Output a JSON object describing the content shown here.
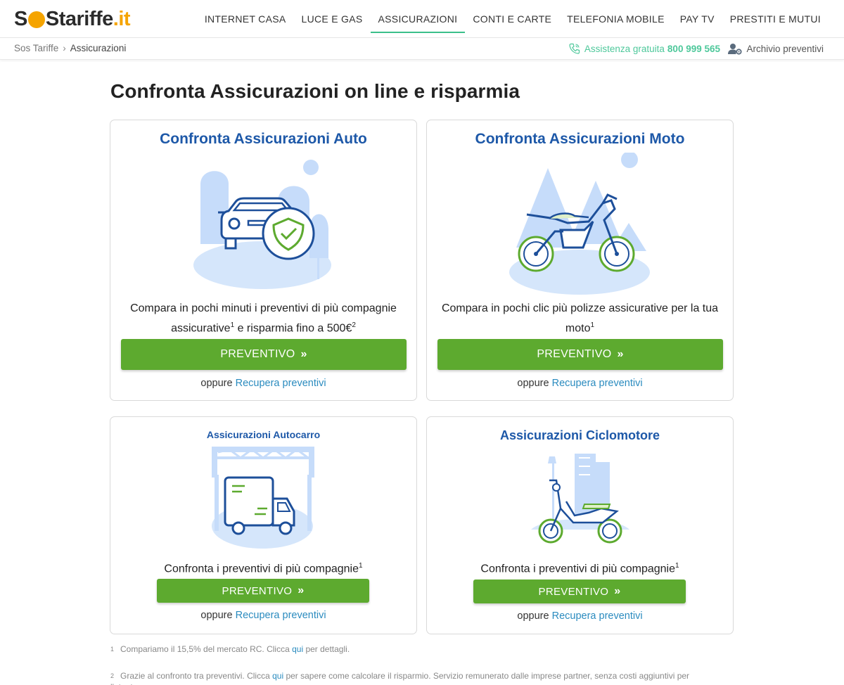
{
  "logo": {
    "part1": "S",
    "part2": "S",
    "part3": "tariffe",
    "part4": ".it"
  },
  "nav": [
    "INTERNET CASA",
    "LUCE E GAS",
    "ASSICURAZIONI",
    "CONTI E CARTE",
    "TELEFONIA MOBILE",
    "PAY TV",
    "PRESTITI E MUTUI"
  ],
  "breadcrumb": {
    "home": "Sos Tariffe",
    "sep": "›",
    "current": "Assicurazioni"
  },
  "assist": {
    "label": "Assistenza gratuita",
    "phone": "800 999 565"
  },
  "archive": {
    "label": "Archivio preventivi"
  },
  "page_title": "Confronta Assicurazioni on line e risparmia",
  "cards": [
    {
      "title": "Confronta Assicurazioni Auto",
      "desc_a": "Compara in pochi minuti i preventivi di più compagnie assicurative",
      "sup1": "1",
      "desc_b": " e risparmia fino a 500€",
      "sup2": "2",
      "button": "PREVENTIVO",
      "or": "oppure",
      "link": "Recupera preventivi"
    },
    {
      "title": "Confronta Assicurazioni Moto",
      "desc_a": "Compara in pochi clic più polizze assicurative per la tua moto",
      "sup1": "1",
      "button": "PREVENTIVO",
      "or": "oppure",
      "link": "Recupera preventivi"
    },
    {
      "title": "Assicurazioni Autocarro",
      "desc_a": "Confronta i preventivi di più compagnie",
      "sup1": "1",
      "button": "PREVENTIVO",
      "or": "oppure",
      "link": "Recupera preventivi"
    },
    {
      "title": "Assicurazioni Ciclomotore",
      "desc_a": "Confronta i preventivi di più compagnie",
      "sup1": "1",
      "button": "PREVENTIVO",
      "or": "oppure",
      "link": "Recupera preventivi"
    }
  ],
  "footnotes": [
    {
      "n": "1",
      "a": "Compariamo il 15,5% del mercato RC. Clicca ",
      "link": "qui",
      "b": " per dettagli."
    },
    {
      "n": "2",
      "a": "Grazie al confronto tra preventivi. Clicca ",
      "link": "qui",
      "b": " per sapere come calcolare il risparmio. Servizio remunerato dalle imprese partner, senza costi aggiuntivi per l'utente."
    }
  ],
  "colors": {
    "brand_orange": "#f5a400",
    "accent_green": "#5daa2f",
    "title_blue": "#1d58a8",
    "link_blue": "#2a8bbf",
    "nav_active": "#3bbf8a"
  }
}
